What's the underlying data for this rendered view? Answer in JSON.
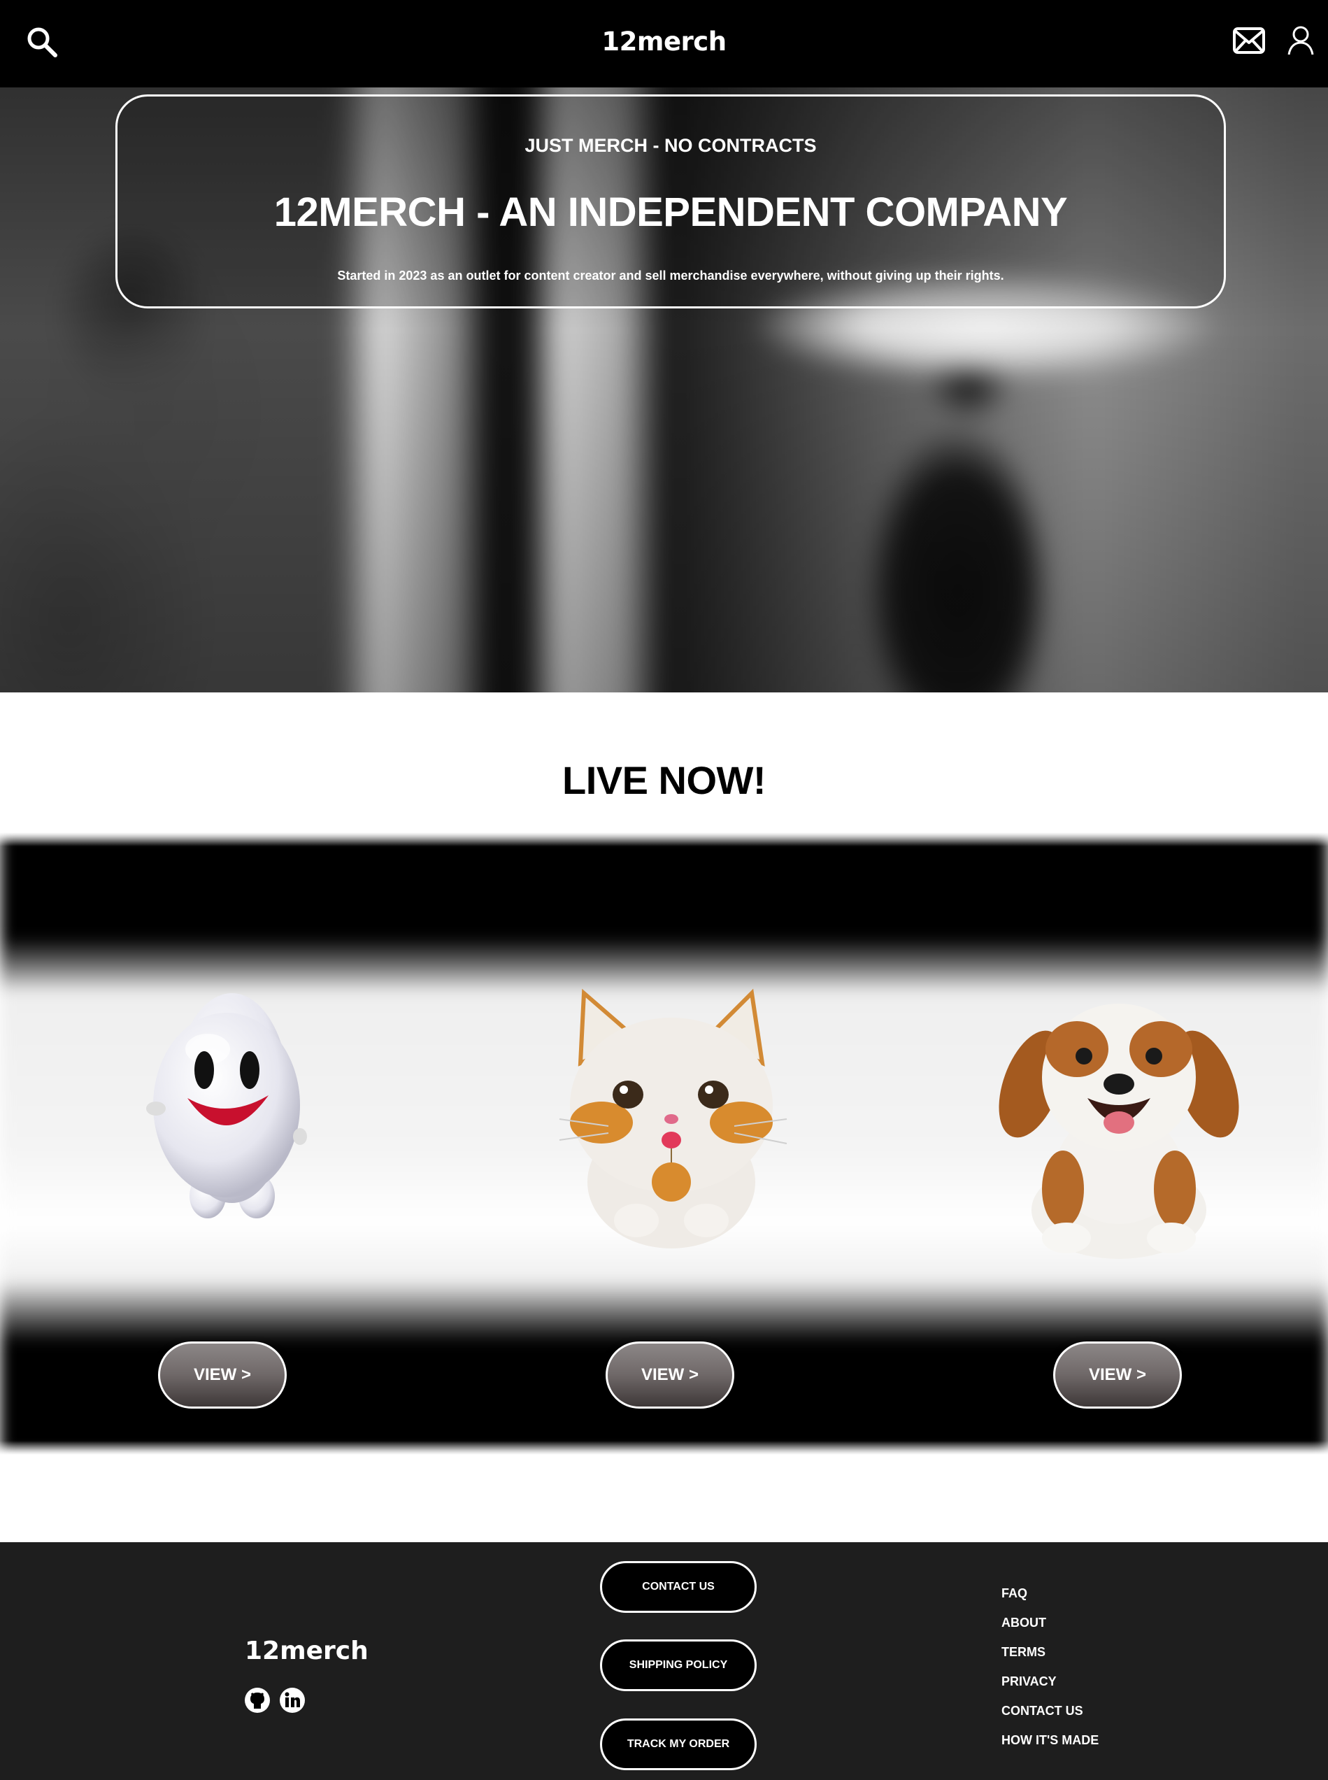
{
  "header": {
    "brand": "12merch",
    "icons": [
      "search-icon",
      "mail-icon",
      "user-icon"
    ]
  },
  "hero": {
    "kicker": "JUST MERCH - NO CONTRACTS",
    "headline": "12MERCH - AN INDEPENDENT COMPANY",
    "subtext": "Started in 2023 as an outlet for content creator and sell merchandise everywhere, without giving up their rights."
  },
  "live": {
    "title": "LIVE NOW!",
    "products": [
      {
        "image": "white-smiley-toy",
        "button": "VIEW >"
      },
      {
        "image": "plush-cat-toy",
        "button": "VIEW >"
      },
      {
        "image": "puppy-figure",
        "button": "VIEW >"
      }
    ]
  },
  "footer": {
    "brand": "12merch",
    "social_icons": [
      "github-icon",
      "linkedin-icon"
    ],
    "buttons": [
      "CONTACT US",
      "SHIPPING POLICY",
      "TRACK MY ORDER"
    ],
    "links": [
      "FAQ",
      "ABOUT",
      "TERMS",
      "PRIVACY",
      "CONTACT US",
      "HOW IT'S MADE"
    ]
  },
  "colors": {
    "header_bg": "#000000",
    "footer_bg": "#1e1e1e",
    "text_light": "#ffffff",
    "button_bg": "#6f6868"
  }
}
